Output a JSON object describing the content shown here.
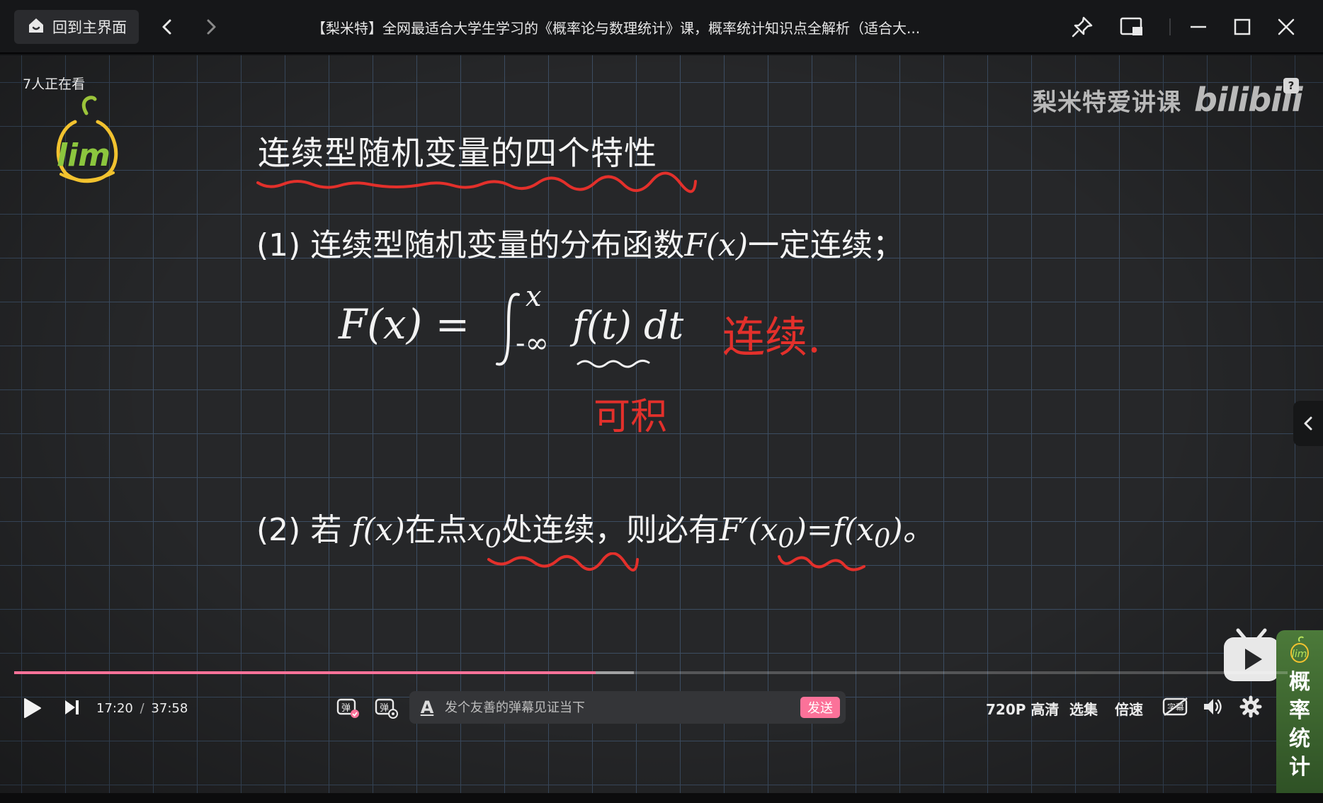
{
  "titlebar": {
    "home_label": "回到主界面",
    "title": "【梨米特】全网最适合大学生学习的《概率论与数理统计》课，概率统计知识点全解析（适合大..."
  },
  "overlay": {
    "viewers": "7人正在看",
    "watermark": "梨米特爱讲课",
    "bilibili": "bilibili",
    "help": "?"
  },
  "slide": {
    "heading": "连续型随机变量的四个特性",
    "p1_prefix": "(1) 连续型随机变量的分布函数",
    "p1_math": "F(x)",
    "p1_suffix": "一定连续；",
    "p2_prefix": "(2) 若",
    "p2_math1": "f(x)",
    "p2_mid1": "在点",
    "p2_x": "x",
    "p2_sub": "0",
    "p2_mid2": "处连续，则必有",
    "p2_math2": "F′(x",
    "p2_math2_end": ")=f(x",
    "p2_end": ")。",
    "handwriting": {
      "formula_lhs": "F(x) =",
      "upper_limit": "x",
      "lower_limit": "-∞",
      "integrand": "f(t) dt",
      "note_continuous": "连续.",
      "note_integrable": "可积"
    }
  },
  "promo": {
    "text": "概率统计"
  },
  "player": {
    "current_time": "17:20",
    "time_sep": "/",
    "duration": "37:58",
    "progress": 0.4568,
    "buffered": 0.418,
    "danmaku_placeholder": "发个友善的弹幕见证当下",
    "send_label": "发送",
    "quality": "720P 高清",
    "episodes": "选集",
    "speed": "倍速",
    "subtitle_icon": "字幕"
  },
  "colors": {
    "accent": "#fb7299",
    "annotation_red": "#e3302b",
    "grid": "#3c4d62"
  }
}
